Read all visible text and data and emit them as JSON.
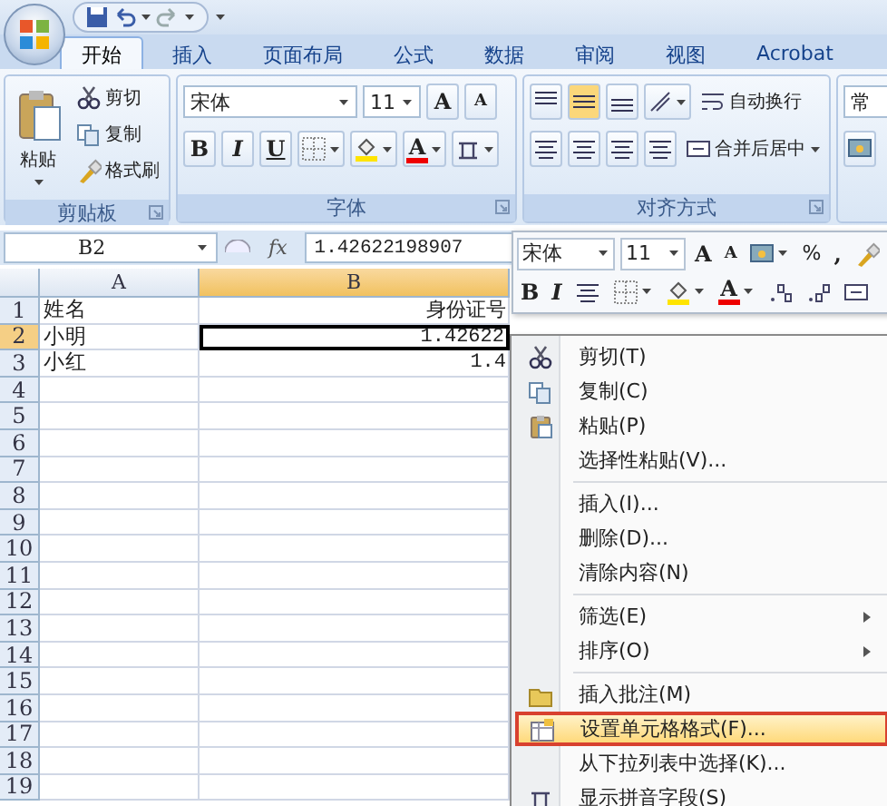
{
  "tabs": [
    {
      "label": "开始",
      "selected": true
    },
    {
      "label": "插入",
      "selected": false
    },
    {
      "label": "页面布局",
      "selected": false
    },
    {
      "label": "公式",
      "selected": false
    },
    {
      "label": "数据",
      "selected": false
    },
    {
      "label": "审阅",
      "selected": false
    },
    {
      "label": "视图",
      "selected": false
    },
    {
      "label": "Acrobat",
      "selected": false
    }
  ],
  "ribbon": {
    "groups": [
      {
        "kind": "clipboard",
        "label": "剪贴板",
        "big_button": "粘贴",
        "items": [
          "剪切",
          "复制",
          "格式刷"
        ]
      },
      {
        "kind": "font",
        "label": "字体",
        "font": "宋体",
        "size": "11",
        "grow": "A",
        "shrink": "A",
        "styles": [
          "B",
          "I",
          "U"
        ],
        "color_letter": "A"
      },
      {
        "kind": "alignment",
        "label": "对齐方式",
        "items": [
          "自动换行",
          "合并后居中"
        ]
      },
      {
        "kind": "number",
        "format": "常"
      }
    ]
  },
  "formula_bar": {
    "name_box": "B2",
    "function_label": "fx",
    "value": "1.42622198907"
  },
  "sheet": {
    "columns": [
      {
        "label": "A",
        "selected": false
      },
      {
        "label": "B",
        "selected": true
      }
    ],
    "rows": [
      {
        "number": "1",
        "selected": false,
        "cells": [
          {
            "text": "姓名",
            "selected": false
          },
          {
            "text": "身份证号",
            "selected": false
          }
        ]
      },
      {
        "number": "2",
        "selected": true,
        "cells": [
          {
            "text": "小明",
            "selected": false
          },
          {
            "text": "1.42622",
            "selected": true
          }
        ]
      },
      {
        "number": "3",
        "selected": false,
        "cells": [
          {
            "text": "小红",
            "selected": false
          },
          {
            "text": "1.4",
            "selected": false
          }
        ]
      },
      {
        "number": "4",
        "selected": false
      },
      {
        "number": "5",
        "selected": false
      },
      {
        "number": "6",
        "selected": false
      },
      {
        "number": "7",
        "selected": false
      },
      {
        "number": "8",
        "selected": false
      },
      {
        "number": "9",
        "selected": false
      },
      {
        "number": "10",
        "selected": false
      },
      {
        "number": "11",
        "selected": false
      },
      {
        "number": "12",
        "selected": false
      },
      {
        "number": "13",
        "selected": false
      },
      {
        "number": "14",
        "selected": false
      },
      {
        "number": "15",
        "selected": false
      },
      {
        "number": "16",
        "selected": false
      },
      {
        "number": "17",
        "selected": false
      },
      {
        "number": "18",
        "selected": false
      },
      {
        "number": "19",
        "selected": false
      }
    ]
  },
  "mini_toolbar": {
    "font": "宋体",
    "size": "11",
    "grow": "A",
    "shrink": "A",
    "percent": "%",
    "comma": ",",
    "bold": "B",
    "italic": "I",
    "color_letter": "A"
  },
  "context_menu": {
    "items": [
      {
        "kind": "item",
        "label": "剪切(T)",
        "submenu": false,
        "selected": false
      },
      {
        "kind": "item",
        "label": "复制(C)",
        "submenu": false,
        "selected": false
      },
      {
        "kind": "item",
        "label": "粘贴(P)",
        "submenu": false,
        "selected": false
      },
      {
        "kind": "item",
        "label": "选择性粘贴(V)...",
        "submenu": false,
        "selected": false
      },
      {
        "kind": "separator"
      },
      {
        "kind": "item",
        "label": "插入(I)...",
        "submenu": false,
        "selected": false
      },
      {
        "kind": "item",
        "label": "删除(D)...",
        "submenu": false,
        "selected": false
      },
      {
        "kind": "item",
        "label": "清除内容(N)",
        "submenu": false,
        "selected": false
      },
      {
        "kind": "separator"
      },
      {
        "kind": "item",
        "label": "筛选(E)",
        "submenu": true,
        "selected": false
      },
      {
        "kind": "item",
        "label": "排序(O)",
        "submenu": true,
        "selected": false
      },
      {
        "kind": "separator"
      },
      {
        "kind": "item",
        "label": "插入批注(M)",
        "submenu": false,
        "selected": false
      },
      {
        "kind": "item",
        "label": "设置单元格格式(F)...",
        "submenu": false,
        "selected": true
      },
      {
        "kind": "item",
        "label": "从下拉列表中选择(K)...",
        "submenu": false,
        "selected": false
      },
      {
        "kind": "item",
        "label": "显示拼音字段(S)",
        "submenu": false,
        "selected": false
      }
    ]
  }
}
